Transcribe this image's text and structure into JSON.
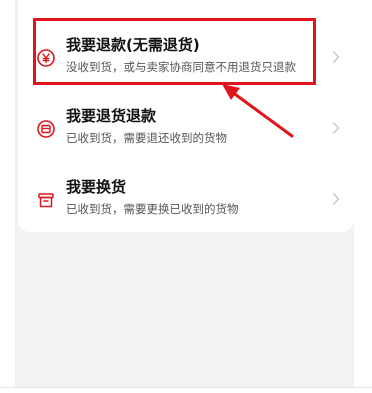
{
  "options": [
    {
      "title": "我要退款(无需退货)",
      "subtitle": "没收到货，或与卖家协商同意不用退货只退款",
      "icon": "yen-circle-icon"
    },
    {
      "title": "我要退货退款",
      "subtitle": "已收到货，需要退还收到的货物",
      "icon": "return-package-icon"
    },
    {
      "title": "我要换货",
      "subtitle": "已收到货，需要更换已收到的货物",
      "icon": "exchange-box-icon"
    }
  ],
  "colors": {
    "accent": "#e0141c",
    "title": "#111111",
    "subtitle": "#555555",
    "background": "#f2f2f2"
  }
}
